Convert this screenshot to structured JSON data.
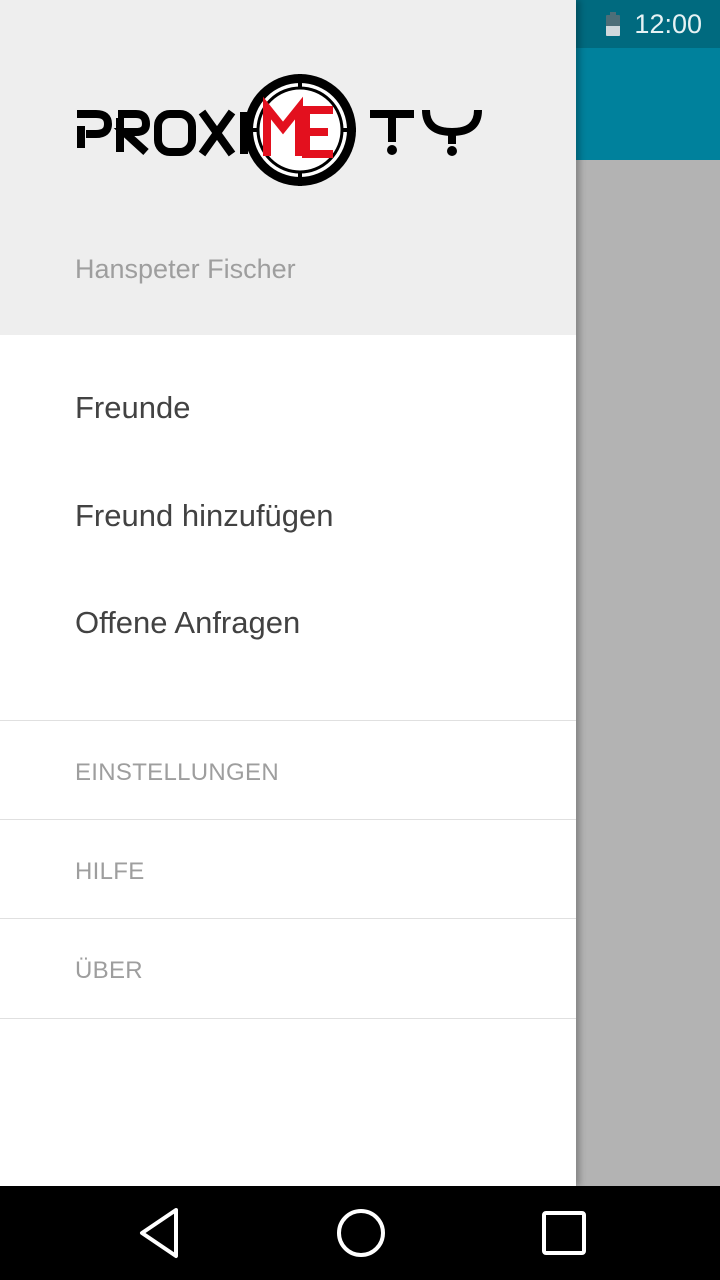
{
  "status_bar": {
    "time": "12:00"
  },
  "drawer": {
    "logo": {
      "text": "PROXIMETY",
      "accent": "ME",
      "accent_color": "#e3101e"
    },
    "user_name": "Hanspeter Fischer",
    "primary_items": [
      {
        "label": "Freunde"
      },
      {
        "label": "Freund hinzufügen"
      },
      {
        "label": "Offene Anfragen"
      }
    ],
    "secondary_items": [
      {
        "label": "EINSTELLUNGEN"
      },
      {
        "label": "HILFE"
      },
      {
        "label": "ÜBER"
      }
    ]
  },
  "nav_bar": {
    "icons": [
      "back-icon",
      "home-icon",
      "recents-icon"
    ]
  },
  "colors": {
    "app_bar": "#00819c",
    "status_bar": "#006a7f",
    "drawer_header": "#eeeeee"
  }
}
